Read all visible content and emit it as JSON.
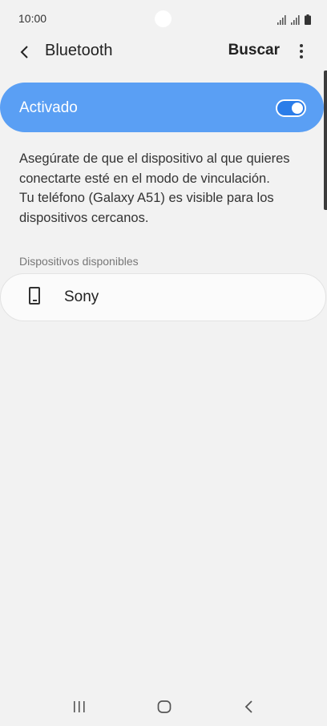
{
  "status_bar": {
    "time": "10:00"
  },
  "header": {
    "title": "Bluetooth",
    "search_label": "Buscar"
  },
  "toggle": {
    "label": "Activado",
    "enabled": true,
    "accent_color": "#5a9ff4"
  },
  "description": {
    "line1": "Asegúrate de que el dispositivo al que quieres",
    "line2": "conectarte esté en el modo de vinculación.",
    "line3": "Tu teléfono (Galaxy A51) es visible para los",
    "line4": "dispositivos cercanos."
  },
  "available_devices": {
    "header": "Dispositivos disponibles",
    "items": [
      {
        "name": "Sony",
        "icon": "phone-icon"
      }
    ]
  }
}
